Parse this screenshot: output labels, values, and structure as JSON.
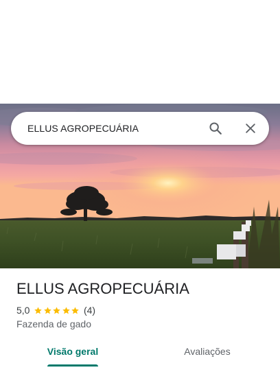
{
  "search": {
    "query": "ELLUS AGROPECUÁRIA",
    "search_icon": "search-icon",
    "close_icon": "close-icon"
  },
  "hero_image": {
    "description_icon": "sunset-field-photo"
  },
  "place": {
    "name": "ELLUS AGROPECUÁRIA",
    "rating": "5,0",
    "rating_value": 5,
    "rating_max": 5,
    "review_count": "(4)",
    "category": "Fazenda de gado"
  },
  "tabs": [
    {
      "label": "Visão geral",
      "active": true
    },
    {
      "label": "Avaliações",
      "active": false
    }
  ],
  "colors": {
    "accent": "#00796b",
    "star": "#fbbc04",
    "text_primary": "#202124",
    "text_secondary": "#5f6368"
  }
}
